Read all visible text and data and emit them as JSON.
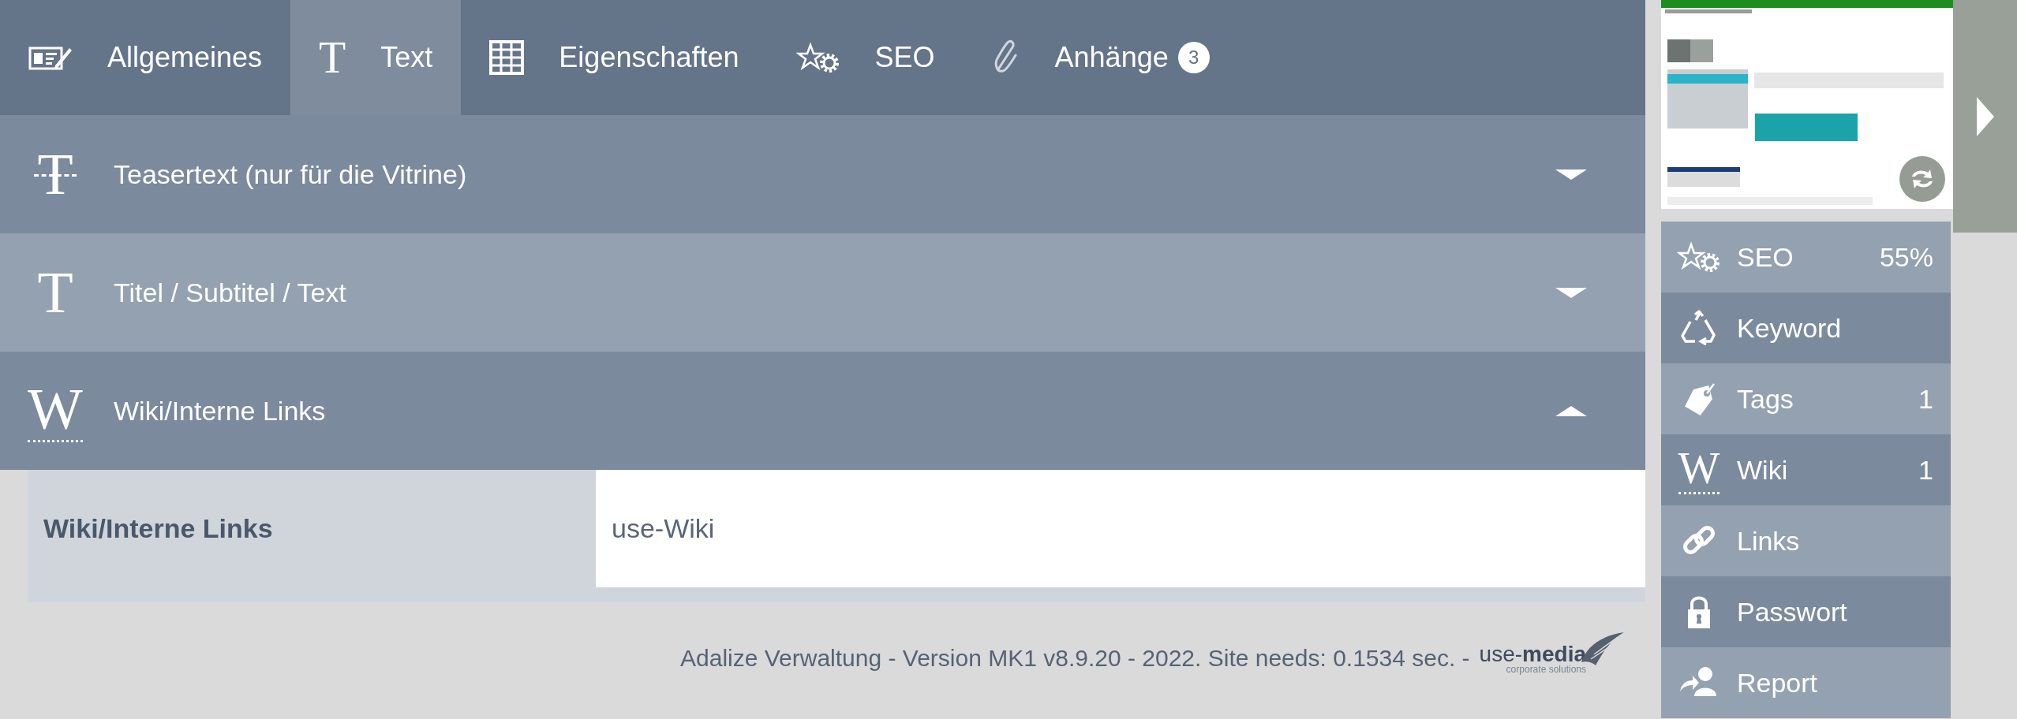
{
  "tabs": [
    {
      "label": "Allgemeines",
      "kind": "newspaper",
      "selected": false
    },
    {
      "label": "Text",
      "glyph": "T",
      "selected": true
    },
    {
      "label": "Eigenschaften",
      "kind": "grid",
      "selected": false
    },
    {
      "label": "SEO",
      "kind": "stargear",
      "selected": false
    },
    {
      "label": "Anhänge",
      "kind": "paperclip",
      "badge": "3",
      "selected": false
    }
  ],
  "sections": [
    {
      "glyph": "T",
      "kind": "strike",
      "title": "Teasertext (nur für die Vitrine)",
      "expanded": false
    },
    {
      "glyph": "T",
      "kind": "plain",
      "title": "Titel / Subtitel / Text",
      "expanded": false
    },
    {
      "glyph": "W",
      "kind": "dotted",
      "title": "Wiki/Interne Links",
      "expanded": true,
      "fields": [
        {
          "label": "Wiki/Interne Links",
          "value": "use-Wiki"
        }
      ]
    }
  ],
  "footer": {
    "text": "Adalize Verwaltung - Version MK1 v8.9.20 - 2022. Site needs: 0.1534 sec. -",
    "brand": "use-**media**",
    "tagline": "corporate solutions"
  },
  "sidebar": {
    "items": [
      {
        "label": "SEO",
        "kind": "stargear",
        "value": "55%"
      },
      {
        "label": "Keyword",
        "kind": "triangle"
      },
      {
        "label": "Tags",
        "kind": "tag",
        "value": "1"
      },
      {
        "label": "Wiki",
        "glyph": "W",
        "value": "1"
      },
      {
        "label": "Links",
        "kind": "link"
      },
      {
        "label": "Passwort",
        "kind": "lock"
      },
      {
        "label": "Report",
        "kind": "share"
      }
    ]
  }
}
